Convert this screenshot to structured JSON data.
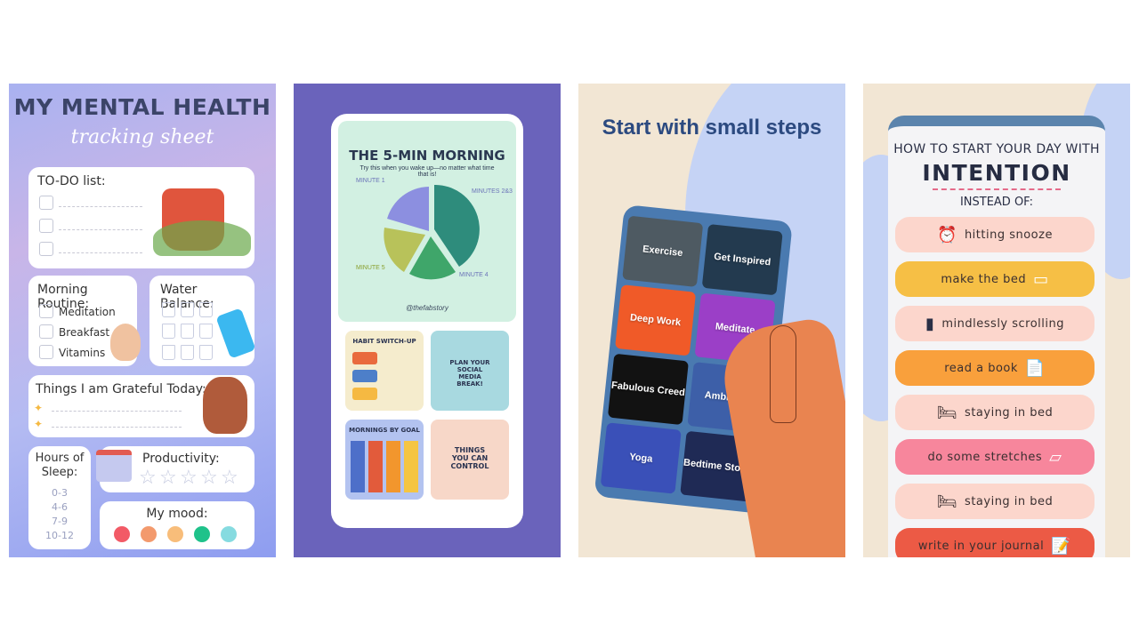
{
  "screenshots": [
    {
      "title": "MY MENTAL HEALTH",
      "subtitle": "tracking sheet",
      "todo": {
        "label": "TO-DO list:"
      },
      "morning_routine": {
        "label": "Morning Routine:",
        "items": [
          "Meditation",
          "Breakfast",
          "Vitamins"
        ]
      },
      "water_balance": {
        "label": "Water Balance:"
      },
      "grateful": {
        "label": "Things I am Grateful Today:"
      },
      "sleep": {
        "label": "Hours of Sleep:",
        "options": [
          "0-3",
          "4-6",
          "7-9",
          "10-12"
        ]
      },
      "productivity": {
        "label": "Productivity:",
        "star": "☆"
      },
      "mood": {
        "label": "My mood:",
        "colors": [
          "#f25a66",
          "#f39a6d",
          "#f8bd7a",
          "#1fc28a",
          "#86dbe0"
        ]
      },
      "sparkle": "✦"
    },
    {
      "infographic": {
        "title": "THE 5-MIN MORNING",
        "subtitle": "Try this when you wake up—no matter what time that is!",
        "minutes": [
          "MINUTE 1",
          "MINUTES 2&3",
          "MINUTE 4",
          "MINUTE 5"
        ],
        "handle": "@thefabstory"
      },
      "thumbs": [
        "HABIT SWITCH-UP",
        "PLAN YOUR SOCIAL MEDIA BREAK!",
        "MORNINGS BY GOAL",
        "THINGS YOU CAN CONTROL"
      ]
    },
    {
      "headline": "Start with small steps",
      "tiles": [
        "Exercise",
        "Get Inspired",
        "Deep Work",
        "Meditate",
        "Fabulous Creed",
        "Ambience",
        "Yoga",
        "Bedtime Stories"
      ]
    },
    {
      "heading_top": "HOW TO START YOUR DAY WITH",
      "heading_main": "INTENTION",
      "heading_sub": "INSTEAD OF:",
      "items": [
        {
          "text": "hitting snooze",
          "icon": "⏰"
        },
        {
          "text": "make the bed",
          "icon": "▭"
        },
        {
          "text": "mindlessly scrolling",
          "icon": "▮"
        },
        {
          "text": "read a book",
          "icon": "📄"
        },
        {
          "text": "staying in bed",
          "icon": "🛏"
        },
        {
          "text": "do some stretches",
          "icon": "▱"
        },
        {
          "text": "staying in bed",
          "icon": "🛏"
        },
        {
          "text": "write in your journal",
          "icon": "📝"
        }
      ]
    }
  ]
}
